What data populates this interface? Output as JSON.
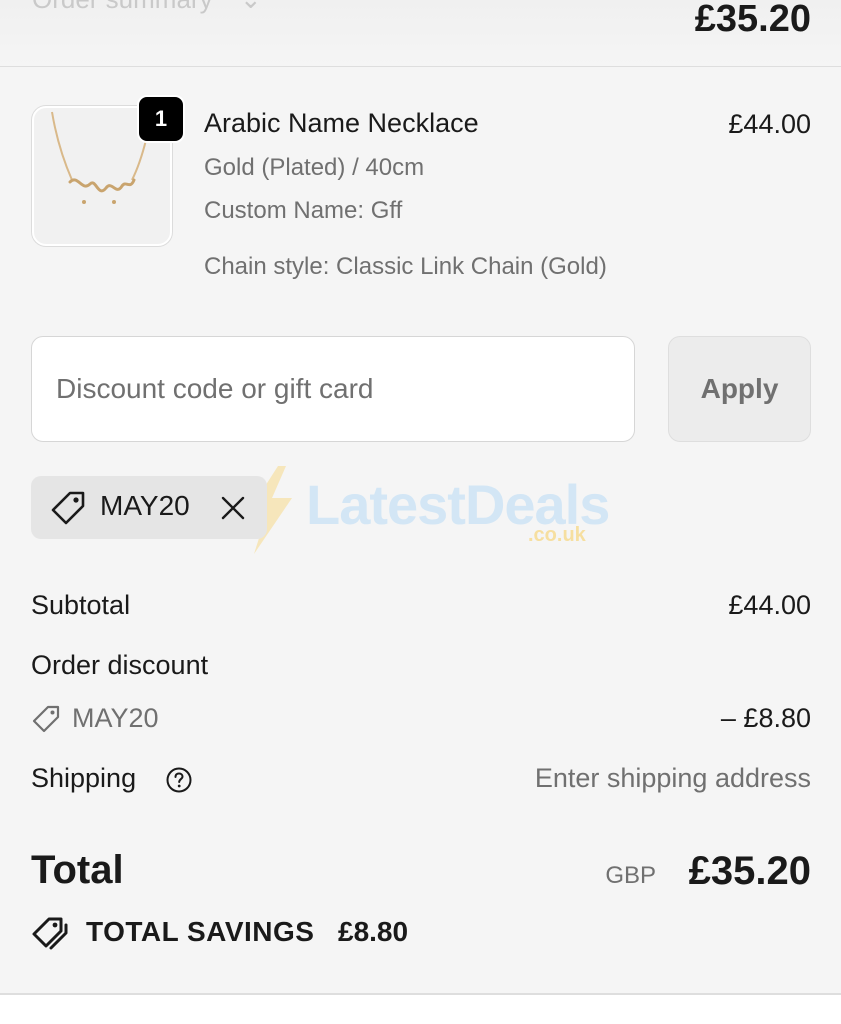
{
  "header": {
    "toggle_label": "Order summary",
    "toggle_chevron": "⌄",
    "total": "£35.20"
  },
  "line_item": {
    "quantity": "1",
    "name": "Arabic Name Necklace",
    "variant": "Gold (Plated) / 40cm",
    "custom_name": "Custom Name: Gff",
    "chain_style": "Chain style: Classic Link Chain (Gold)",
    "price": "£44.00",
    "thumbnail_icon": "necklace-image"
  },
  "discount_form": {
    "placeholder": "Discount code or gift card",
    "apply_label": "Apply",
    "applied_code": "MAY20"
  },
  "watermark": {
    "brand": "LatestDeals",
    "domain": ".co.uk"
  },
  "costs": {
    "subtotal_label": "Subtotal",
    "subtotal_value": "£44.00",
    "discount_label": "Order discount",
    "discount_code": "MAY20",
    "discount_value": "– £8.80",
    "shipping_label": "Shipping",
    "shipping_value": "Enter shipping address"
  },
  "total": {
    "label": "Total",
    "currency": "GBP",
    "value": "£35.20"
  },
  "savings": {
    "label": "TOTAL SAVINGS",
    "value": "£8.80"
  },
  "colors": {
    "panel_background": "#f5f5f5",
    "text_primary": "#1a1a1a",
    "text_secondary": "#707070",
    "badge": "#000000",
    "chip_background": "#e5e5e5"
  }
}
